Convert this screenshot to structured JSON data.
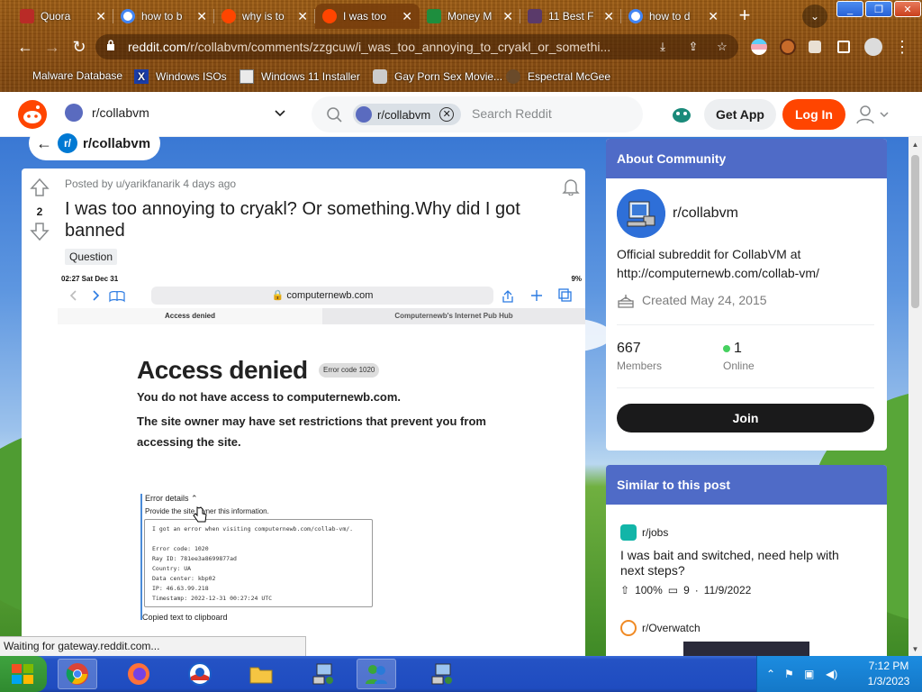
{
  "browser": {
    "tabs": [
      {
        "title": "Quora",
        "color": "#b92b27"
      },
      {
        "title": "how to b",
        "color": "#ffffff"
      },
      {
        "title": "why is to",
        "color": "#ff4500"
      },
      {
        "title": "I was too",
        "color": "#ff4500"
      },
      {
        "title": "Money M",
        "color": "#1e8e3e"
      },
      {
        "title": "11 Best F",
        "color": "#5a3a6a"
      },
      {
        "title": "how to d",
        "color": "#ffffff"
      }
    ],
    "url_domain": "reddit.com",
    "url_path": "/r/collabvm/comments/zzgcuw/i_was_too_annoying_to_cryakl_or_somethi...",
    "bookmarks": [
      "Malware Database",
      "Windows ISOs",
      "Windows 11 Installer",
      "Gay Porn Sex Movie...",
      "Espectral McGee"
    ]
  },
  "reddit_header": {
    "community": "r/collabvm",
    "search_chip": "r/collabvm",
    "search_placeholder": "Search Reddit",
    "get_app": "Get App",
    "login": "Log In"
  },
  "back_pill": {
    "label": "r/collabvm"
  },
  "post": {
    "score": "2",
    "meta": "Posted by u/yarikfanarik 4 days ago",
    "title": "I was too annoying to cryakl? Or something.Why did I got banned",
    "flair": "Question",
    "screenshot": {
      "time": "02:27  Sat Dec 31",
      "battery": "9%",
      "address": "🔒 computernewb.com",
      "tab_active": "Access denied",
      "tab_other": "Computernewb's Internet Pub Hub",
      "heading": "Access denied",
      "error_code": "Error code 1020",
      "line1": "You do not have access to computernewb.com.",
      "line2": "The site owner may have set restrictions that prevent you from accessing the site.",
      "details_heading": "Error details ⌃",
      "details_sub": "Provide the site owner this information.",
      "details_lines": [
        "I got an error when visiting computernewb.com/collab-vm/.",
        "",
        "Error code: 1020",
        "Ray ID: 781ee3a8699877ad",
        "Country: UA",
        "Data center: kbp02",
        "IP: 46.63.99.218",
        "Timestamp: 2022-12-31 00:27:24 UTC"
      ],
      "copied": "Copied text to clipboard"
    }
  },
  "about": {
    "header": "About Community",
    "name": "r/collabvm",
    "description": "Official subreddit for CollabVM at http://computernewb.com/collab-vm/",
    "created": "Created May 24, 2015",
    "members_count": "667",
    "members_label": "Members",
    "online_count": "1",
    "online_label": "Online",
    "join": "Join"
  },
  "similar": {
    "header": "Similar to this post",
    "items": [
      {
        "community": "r/jobs",
        "title": "I was bait and switched, need help with next steps?",
        "upvote": "100%",
        "comments": "9",
        "date": "11/9/2022"
      },
      {
        "community": "r/Overwatch"
      }
    ]
  },
  "status_text": "Waiting for gateway.reddit.com...",
  "taskbar": {
    "time": "7:12 PM",
    "date": "1/3/2023"
  },
  "colors": {
    "reddit_orange": "#ff4500",
    "card_header": "#4f6bc7",
    "join_button": "#1a1a1b"
  }
}
